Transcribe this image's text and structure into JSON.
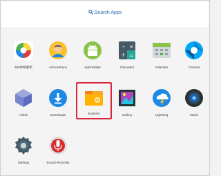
{
  "search": {
    "label": "Search Apps",
    "icon": "search-icon"
  },
  "apps": [
    {
      "label": "360手机助手",
      "icon": "360-assistant-icon"
    },
    {
      "label": "AirmoreFace",
      "icon": "airmore-face-icon"
    },
    {
      "label": "ApkInstaller",
      "icon": "android-installer-icon"
    },
    {
      "label": "Calculator",
      "icon": "calculator-icon"
    },
    {
      "label": "Calendar",
      "icon": "calendar-icon"
    },
    {
      "label": "Camera",
      "icon": "camera-icon"
    },
    {
      "label": "Clock",
      "icon": "clock-icon"
    },
    {
      "label": "Downloads",
      "icon": "download-icon"
    },
    {
      "label": "Explorer",
      "icon": "folder-icon",
      "selected": true
    },
    {
      "label": "Gallery",
      "icon": "gallery-icon"
    },
    {
      "label": "Lightning",
      "icon": "lightning-icon"
    },
    {
      "label": "Music",
      "icon": "speaker-icon"
    },
    {
      "label": "Settings",
      "icon": "gear-icon"
    },
    {
      "label": "Sound Recorder",
      "icon": "microphone-icon"
    }
  ],
  "colors": {
    "accent": "#2b6cb3",
    "selection": "#d7263d",
    "background": "#f4f4f4"
  }
}
